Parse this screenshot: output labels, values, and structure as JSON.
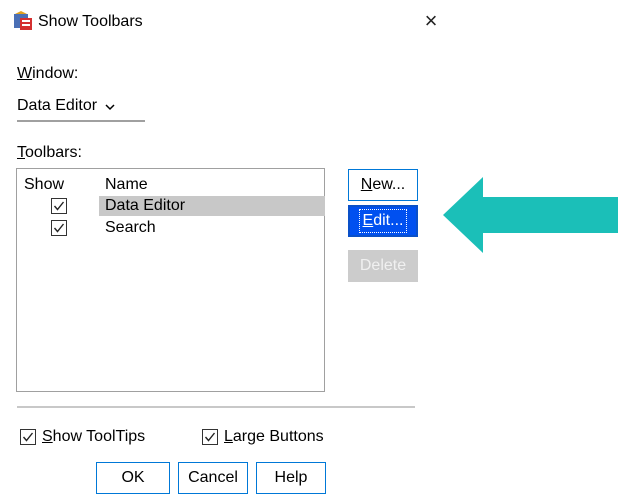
{
  "window": {
    "title": "Show Toolbars",
    "close_glyph": "×"
  },
  "window_selector": {
    "label": "Window:",
    "selected": "Data Editor",
    "chevron": "⌄"
  },
  "toolbars": {
    "label": "Toolbars:",
    "columns": [
      "Show",
      "Name"
    ],
    "rows": [
      {
        "checked": true,
        "name": "Data Editor",
        "selected": true
      },
      {
        "checked": true,
        "name": "Search",
        "selected": false
      }
    ]
  },
  "side_buttons": {
    "new": "New...",
    "edit": "Edit...",
    "delete": "Delete"
  },
  "options": {
    "show_tooltips": {
      "label": "Show ToolTips",
      "checked": true
    },
    "large_buttons": {
      "label": "Large Buttons",
      "checked": true
    }
  },
  "footer_buttons": {
    "ok": "OK",
    "cancel": "Cancel",
    "help": "Help"
  },
  "colors": {
    "accent_arrow": "#1bbfb8",
    "edit_button": "#0050f0",
    "selection": "#c8c8c8"
  },
  "icons": {
    "app": "toolbar-app-icon",
    "arrow": "pointer-arrow-icon"
  }
}
